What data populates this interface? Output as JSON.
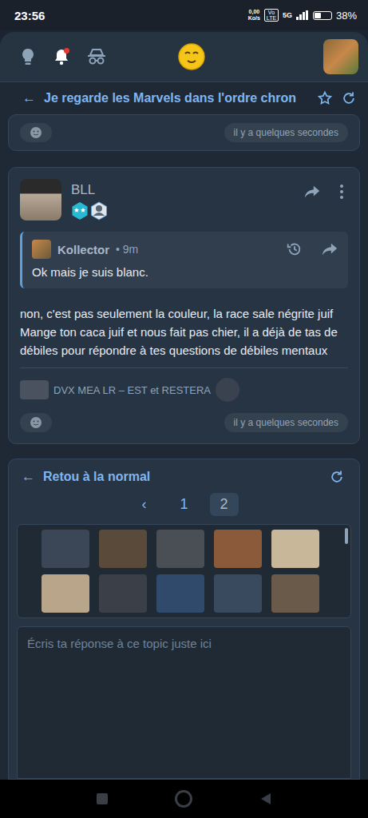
{
  "status_bar": {
    "time": "23:56",
    "speed": "0,00",
    "speed_unit": "Ko/s",
    "volte": "Vo LTE",
    "network": "5G",
    "battery": "38%",
    "battery_level": 0.38
  },
  "header": {
    "notifications_unread": true
  },
  "topic": {
    "back": "←",
    "title": "Je regarde les Marvels dans l'ordre chron"
  },
  "previous_post": {
    "time": "il y a quelques secondes"
  },
  "post": {
    "author": "BLL",
    "quote": {
      "author": "Kollector",
      "separator": "•",
      "time": "9m",
      "text": "Ok mais je suis blanc."
    },
    "body": [
      "non, c'est pas seulement la couleur, la race sale négrite juif",
      "Mange ton caca juif et nous fait pas chier, il a déjà de tas de débiles pour répondre à tes questions de débiles mentaux"
    ],
    "signature": "DVX MEA LR – EST et RESTERA",
    "time": "il y a quelques secondes"
  },
  "reply_panel": {
    "back": "←",
    "title": "Retou à la normal",
    "pagination": [
      {
        "label": "‹",
        "selected": false
      },
      {
        "label": "1",
        "selected": false
      },
      {
        "label": "2",
        "selected": true
      }
    ],
    "stickers": [
      {
        "color": "#3b4656"
      },
      {
        "color": "#5a4a3a"
      },
      {
        "color": "#4a4f55"
      },
      {
        "color": "#8a5a3a"
      },
      {
        "color": "#c9b79a"
      },
      {
        "color": "#b9a58a"
      },
      {
        "color": "#3a3f48"
      },
      {
        "color": "#2f4a6a"
      },
      {
        "color": "#3a4a5e"
      },
      {
        "color": "#6a5a4a"
      },
      {
        "color": "#4a4a52"
      },
      {
        "color": "#3e4654"
      },
      {
        "color": "#7a8a6a"
      },
      {
        "color": "#b33a2e"
      },
      {
        "color": "#4a5060"
      }
    ],
    "placeholder": "Écris ta réponse à ce topic juste ici"
  }
}
